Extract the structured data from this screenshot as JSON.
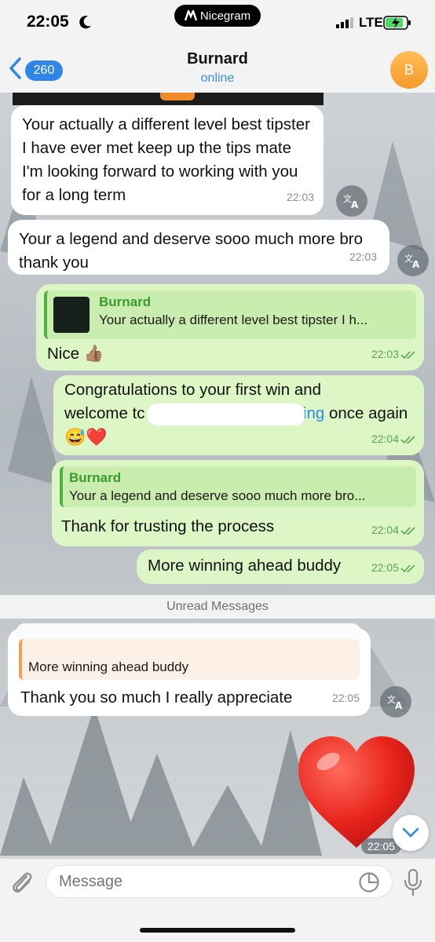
{
  "status_bar": {
    "time": "22:05",
    "carrier_app": "Nicegram",
    "network": "LTE"
  },
  "header": {
    "back_count": "260",
    "title": "Burnard",
    "status": "online",
    "avatar_letter": "B"
  },
  "messages": [
    {
      "text": "Your actually a different level best tipster I have ever met keep up the tips mate I'm looking forward to working with you for a long term",
      "time": "22:03"
    },
    {
      "text": "Your a legend and deserve sooo much more bro thank you",
      "time": "22:03"
    },
    {
      "reply_name": "Burnard",
      "reply_text": "Your actually a different level best tipster I h...",
      "text": "Nice 👍🏽",
      "time": "22:03"
    },
    {
      "text_a": "Congratulations to your first win and",
      "text_b": "welcome tc",
      "text_c": "ning",
      "text_d": " once again",
      "emoji": "😅❤️",
      "time": "22:04"
    },
    {
      "reply_name": "Burnard",
      "reply_text": "Your a legend and deserve sooo much more bro...",
      "text": "Thank for trusting the process",
      "time": "22:04"
    },
    {
      "text": "More winning ahead buddy",
      "time": "22:05"
    },
    {
      "reply_text": "More winning ahead buddy",
      "text": "Thank you so much I really appreciate",
      "time": "22:05"
    }
  ],
  "unread_label": "Unread Messages",
  "heart_time": "22:05",
  "input": {
    "placeholder": "Message"
  },
  "colors": {
    "accent": "#2f86e8",
    "outgoing": "#dcf7c5",
    "incoming": "#ffffff"
  }
}
